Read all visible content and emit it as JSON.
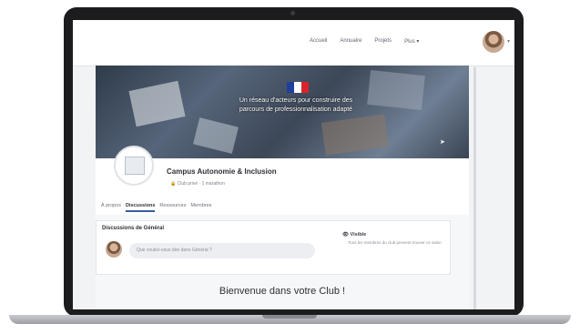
{
  "nav": {
    "links": [
      "Accueil",
      "Annuaire",
      "Projets",
      "Plus ▾"
    ]
  },
  "banner": {
    "text": "Un réseau d'acteurs pour construire des parcours de professionnalisation adapté",
    "flag_colors": [
      "#1f3f9a",
      "#ffffff",
      "#d9242b"
    ]
  },
  "group": {
    "name": "Campus Autonomie & Inclusion",
    "meta": "Club privé · 1 marathon",
    "tabs": [
      "À propos",
      "Discussions",
      "Ressources",
      "Membres"
    ],
    "active_tab": "Discussions"
  },
  "discussion": {
    "title": "Discussions de Général",
    "placeholder": "Que voulez-vous dire dans Général ?",
    "side_title": "Visible",
    "side_text": "Tous les membres du club peuvent trouver ce salon"
  },
  "welcome": "Bienvenue dans votre Club !",
  "colors": {
    "accent": "#3b5ba8",
    "laptop_frame": "#1c1c1e"
  }
}
